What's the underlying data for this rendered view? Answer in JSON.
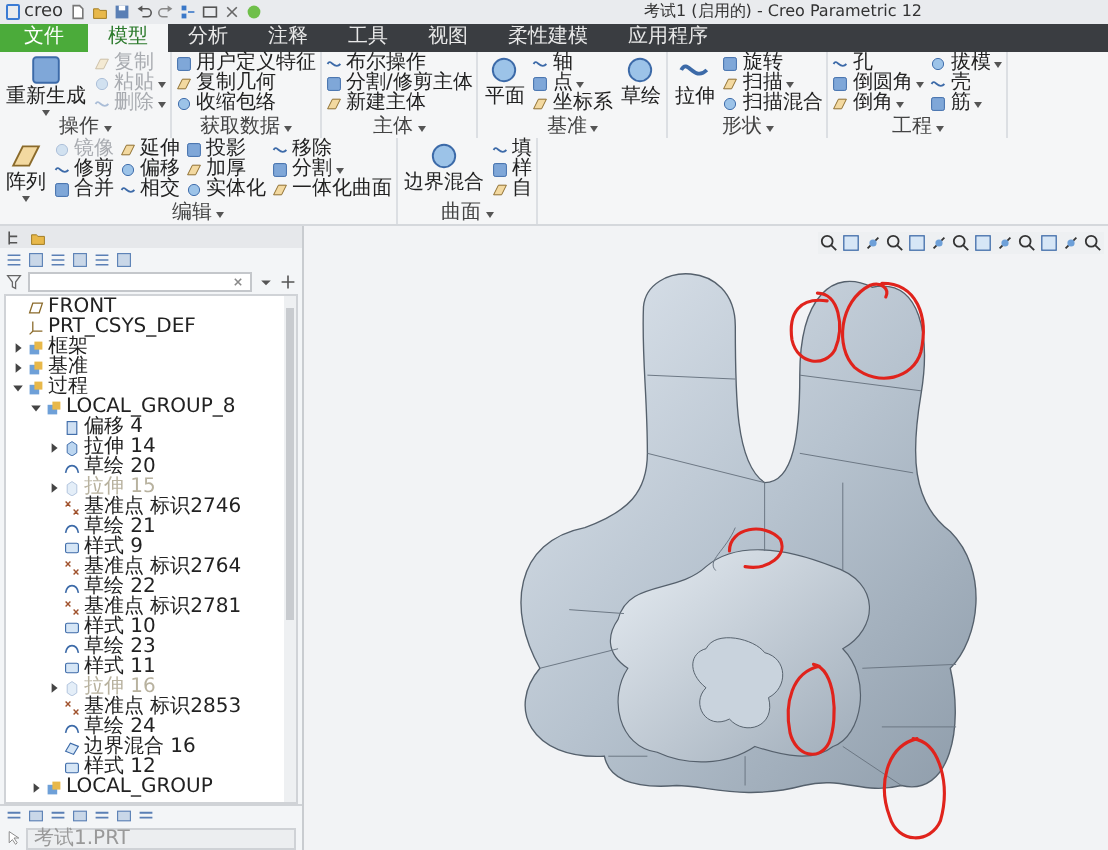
{
  "window": {
    "logo": "creo",
    "title": "考试1 (启用的) - Creo Parametric 12"
  },
  "tabs": [
    {
      "label": "文件",
      "kind": "file",
      "selected": false
    },
    {
      "label": "模型",
      "kind": "tab",
      "selected": true
    },
    {
      "label": "分析",
      "kind": "tab",
      "selected": false
    },
    {
      "label": "注释",
      "kind": "tab",
      "selected": false
    },
    {
      "label": "工具",
      "kind": "tab",
      "selected": false
    },
    {
      "label": "视图",
      "kind": "tab",
      "selected": false
    },
    {
      "label": "柔性建模",
      "kind": "tab",
      "selected": false
    },
    {
      "label": "应用程序",
      "kind": "tab",
      "selected": false
    }
  ],
  "ribbon": {
    "groups": [
      {
        "label": "操作",
        "columns": [
          [
            {
              "label": "重新生成",
              "kind": "large",
              "dropdown": true,
              "disabled": false
            }
          ],
          [
            {
              "label": "复制",
              "kind": "small",
              "dropdown": false,
              "disabled": true
            },
            {
              "label": "粘贴",
              "kind": "small",
              "dropdown": true,
              "disabled": true
            },
            {
              "label": "删除",
              "kind": "small",
              "dropdown": true,
              "disabled": true
            }
          ]
        ]
      },
      {
        "label": "获取数据",
        "columns": [
          [
            {
              "label": "用户定义特征",
              "kind": "small",
              "dropdown": false,
              "disabled": false
            },
            {
              "label": "复制几何",
              "kind": "small",
              "dropdown": false,
              "disabled": false
            },
            {
              "label": "收缩包络",
              "kind": "small",
              "dropdown": false,
              "disabled": false
            }
          ]
        ]
      },
      {
        "label": "主体",
        "columns": [
          [
            {
              "label": "布尔操作",
              "kind": "small",
              "dropdown": false,
              "disabled": false
            },
            {
              "label": "分割/修剪主体",
              "kind": "small",
              "dropdown": false,
              "disabled": false
            },
            {
              "label": "新建主体",
              "kind": "small",
              "dropdown": false,
              "disabled": false
            }
          ]
        ]
      },
      {
        "label": "基准",
        "columns": [
          [
            {
              "label": "平面",
              "kind": "large",
              "dropdown": false,
              "disabled": false
            }
          ],
          [
            {
              "label": "轴",
              "kind": "small",
              "dropdown": false,
              "disabled": false
            },
            {
              "label": "点",
              "kind": "small",
              "dropdown": true,
              "disabled": false
            },
            {
              "label": "坐标系",
              "kind": "small",
              "dropdown": false,
              "disabled": false
            }
          ],
          [
            {
              "label": "草绘",
              "kind": "large",
              "dropdown": false,
              "disabled": false
            }
          ]
        ]
      },
      {
        "label": "形状",
        "columns": [
          [
            {
              "label": "拉伸",
              "kind": "large",
              "dropdown": false,
              "disabled": false
            }
          ],
          [
            {
              "label": "旋转",
              "kind": "small",
              "dropdown": false,
              "disabled": false
            },
            {
              "label": "扫描",
              "kind": "small",
              "dropdown": true,
              "disabled": false
            },
            {
              "label": "扫描混合",
              "kind": "small",
              "dropdown": false,
              "disabled": false
            }
          ]
        ]
      },
      {
        "label": "工程",
        "columns": [
          [
            {
              "label": "孔",
              "kind": "small",
              "dropdown": false,
              "disabled": false
            },
            {
              "label": "倒圆角",
              "kind": "small",
              "dropdown": true,
              "disabled": false
            },
            {
              "label": "倒角",
              "kind": "small",
              "dropdown": true,
              "disabled": false
            }
          ],
          [
            {
              "label": "拔模",
              "kind": "small",
              "dropdown": true,
              "disabled": false
            },
            {
              "label": "壳",
              "kind": "small",
              "dropdown": false,
              "disabled": false
            },
            {
              "label": "筋",
              "kind": "small",
              "dropdown": true,
              "disabled": false
            }
          ]
        ]
      },
      {
        "label": "编辑",
        "columns": [
          [
            {
              "label": "阵列",
              "kind": "large",
              "dropdown": true,
              "disabled": false
            }
          ],
          [
            {
              "label": "镜像",
              "kind": "small",
              "dropdown": false,
              "disabled": true
            },
            {
              "label": "修剪",
              "kind": "small",
              "dropdown": false,
              "disabled": false
            },
            {
              "label": "合并",
              "kind": "small",
              "dropdown": false,
              "disabled": false
            }
          ],
          [
            {
              "label": "延伸",
              "kind": "small",
              "dropdown": false,
              "disabled": false
            },
            {
              "label": "偏移",
              "kind": "small",
              "dropdown": false,
              "disabled": false
            },
            {
              "label": "相交",
              "kind": "small",
              "dropdown": false,
              "disabled": false
            }
          ],
          [
            {
              "label": "投影",
              "kind": "small",
              "dropdown": false,
              "disabled": false
            },
            {
              "label": "加厚",
              "kind": "small",
              "dropdown": false,
              "disabled": false
            },
            {
              "label": "实体化",
              "kind": "small",
              "dropdown": false,
              "disabled": false
            }
          ],
          [
            {
              "label": "移除",
              "kind": "small",
              "dropdown": false,
              "disabled": false
            },
            {
              "label": "分割",
              "kind": "small",
              "dropdown": true,
              "disabled": false
            },
            {
              "label": "一体化曲面",
              "kind": "small",
              "dropdown": false,
              "disabled": false
            }
          ]
        ]
      },
      {
        "label": "曲面",
        "columns": [
          [
            {
              "label": "边界混合",
              "kind": "large",
              "dropdown": false,
              "disabled": false
            }
          ],
          [
            {
              "label": "填",
              "kind": "small",
              "dropdown": false,
              "disabled": false
            },
            {
              "label": "样",
              "kind": "small",
              "dropdown": false,
              "disabled": false
            },
            {
              "label": "自",
              "kind": "small",
              "dropdown": false,
              "disabled": false
            }
          ]
        ]
      }
    ]
  },
  "model_tree": {
    "items": [
      {
        "label": "FRONT",
        "kind": "plane",
        "disabled": false
      },
      {
        "label": "PRT_CSYS_DEF",
        "kind": "csys",
        "disabled": false
      },
      {
        "label": "框架",
        "kind": "folder",
        "disabled": false,
        "expanded": false
      },
      {
        "label": "基准",
        "kind": "folder",
        "disabled": false,
        "expanded": false
      },
      {
        "label": "过程",
        "kind": "folder",
        "disabled": false,
        "expanded": true,
        "children": [
          {
            "label": "LOCAL_GROUP_8",
            "kind": "folder",
            "disabled": false,
            "expanded": true,
            "children": [
              {
                "label": "偏移 4",
                "kind": "offset",
                "disabled": false
              },
              {
                "label": "拉伸 14",
                "kind": "extrude",
                "disabled": false,
                "expanded": false
              },
              {
                "label": "草绘 20",
                "kind": "sketch",
                "disabled": false
              },
              {
                "label": "拉伸 15",
                "kind": "extrude",
                "disabled": true,
                "expanded": false
              },
              {
                "label": "基准点 标识2746",
                "kind": "point",
                "disabled": false
              },
              {
                "label": "草绘 21",
                "kind": "sketch",
                "disabled": false
              },
              {
                "label": "样式 9",
                "kind": "style",
                "disabled": false
              },
              {
                "label": "基准点 标识2764",
                "kind": "point",
                "disabled": false
              },
              {
                "label": "草绘 22",
                "kind": "sketch",
                "disabled": false
              },
              {
                "label": "基准点 标识2781",
                "kind": "point",
                "disabled": false
              },
              {
                "label": "样式 10",
                "kind": "style",
                "disabled": false
              },
              {
                "label": "草绘 23",
                "kind": "sketch",
                "disabled": false
              },
              {
                "label": "样式 11",
                "kind": "style",
                "disabled": false
              },
              {
                "label": "拉伸 16",
                "kind": "extrude",
                "disabled": true,
                "expanded": false
              },
              {
                "label": "基准点 标识2853",
                "kind": "point",
                "disabled": false
              },
              {
                "label": "草绘 24",
                "kind": "sketch",
                "disabled": false
              },
              {
                "label": "边界混合 16",
                "kind": "blend",
                "disabled": false
              },
              {
                "label": "样式 12",
                "kind": "style",
                "disabled": false
              }
            ]
          },
          {
            "label": "LOCAL_GROUP",
            "kind": "folder",
            "disabled": false,
            "expanded": false
          }
        ]
      }
    ]
  },
  "status_field": {
    "value": "考试1.PRT",
    "disabled": true
  }
}
